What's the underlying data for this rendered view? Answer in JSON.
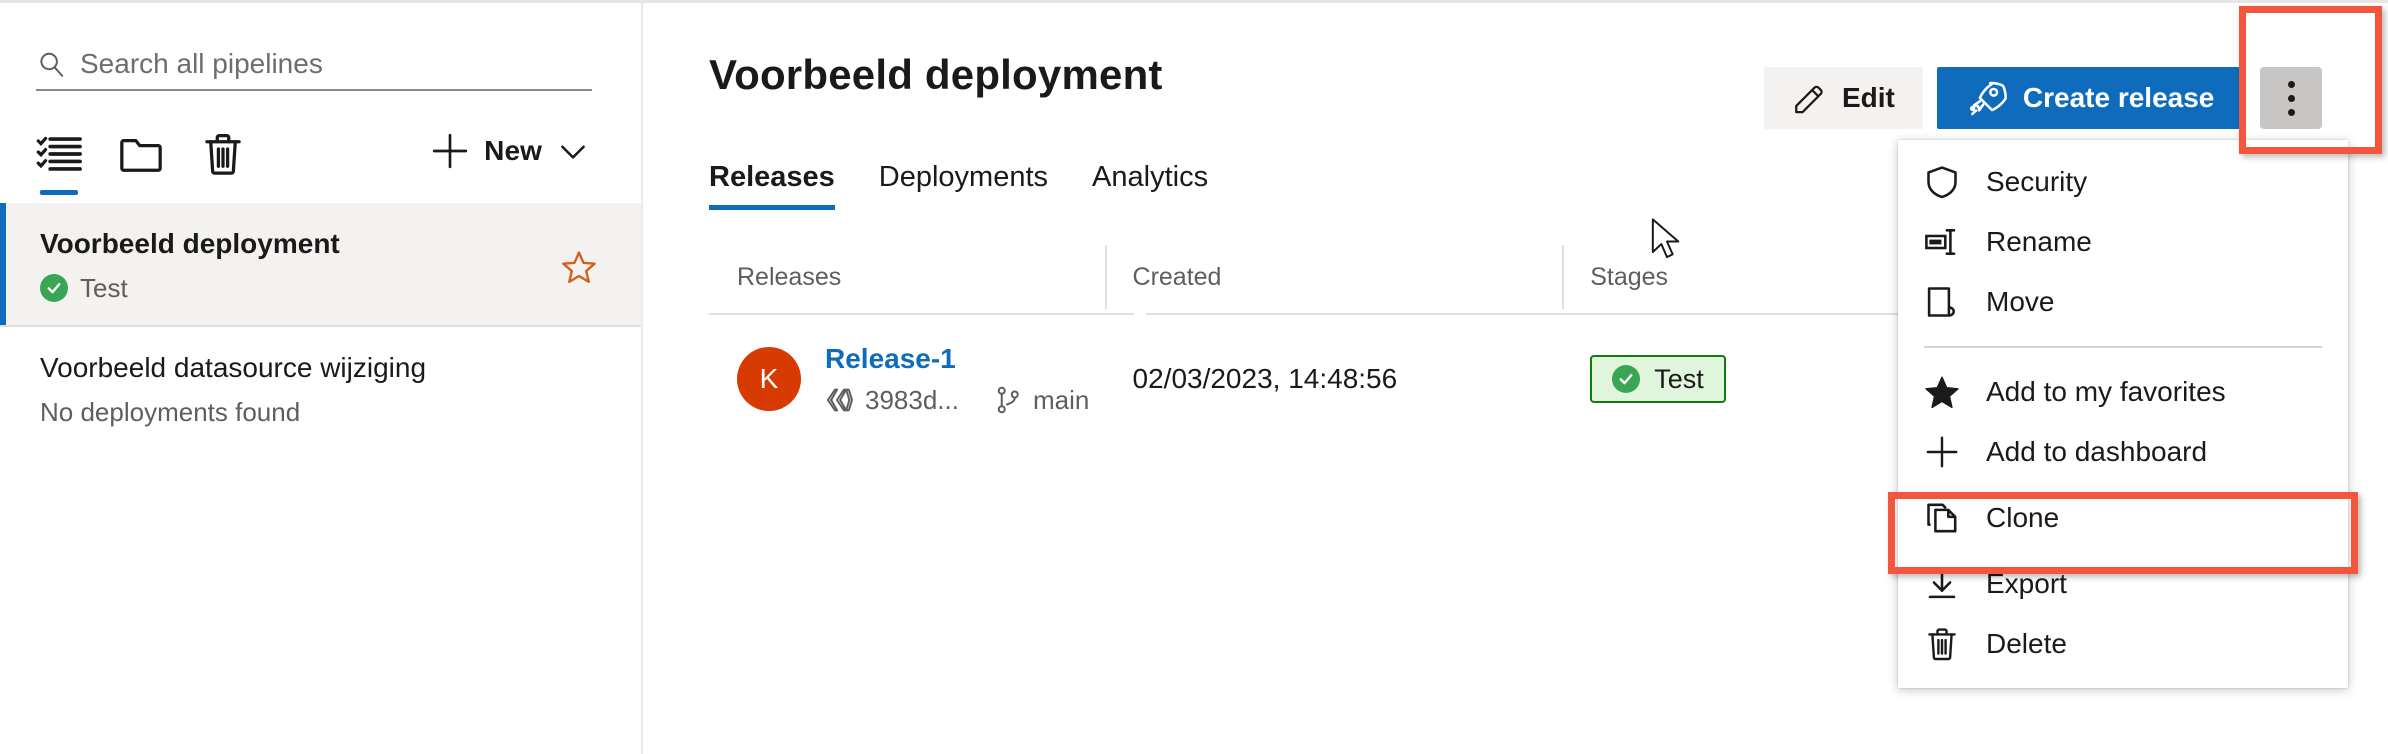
{
  "sidebar": {
    "search": {
      "placeholder": "Search all pipelines",
      "value": "",
      "icon": "search-icon"
    },
    "toolbar": {
      "icons": [
        {
          "name": "pipelines-list-icon",
          "active": true
        },
        {
          "name": "folder-icon",
          "active": false
        },
        {
          "name": "recycle-bin-icon",
          "active": false
        }
      ],
      "new_label": "New",
      "plus_icon": "plus-icon",
      "chevron_icon": "chevron-down-icon"
    },
    "pipelines": [
      {
        "name": "Voorbeeld deployment",
        "status": "Test",
        "status_icon": "check-circle-icon",
        "selected": true,
        "favorite_icon": "star-outline-icon"
      },
      {
        "name": "Voorbeeld datasource wijziging",
        "status": "No deployments found",
        "status_icon": "",
        "selected": false,
        "favorite_icon": ""
      }
    ]
  },
  "main": {
    "title": "Voorbeeld deployment",
    "actions": {
      "edit_label": "Edit",
      "edit_icon": "pencil-icon",
      "create_label": "Create release",
      "create_icon": "rocket-icon",
      "more_label": "More options",
      "more_icon": "more-vertical-icon"
    },
    "tabs": [
      {
        "label": "Releases",
        "active": true
      },
      {
        "label": "Deployments",
        "active": false
      },
      {
        "label": "Analytics",
        "active": false
      }
    ],
    "table": {
      "columns": [
        "Releases",
        "Created",
        "Stages"
      ],
      "rows": [
        {
          "avatar_initial": "K",
          "release_name": "Release-1",
          "commit_icon": "commit-icon",
          "commit": "3983d...",
          "branch_icon": "branch-icon",
          "branch": "main",
          "created": "02/03/2023, 14:48:56",
          "stage_label": "Test",
          "stage_icon": "check-circle-icon"
        }
      ]
    },
    "grid_icon": "table-grid-icon"
  },
  "context_menu": {
    "items": [
      {
        "label": "Security",
        "icon": "shield-icon",
        "separator_after": false
      },
      {
        "label": "Rename",
        "icon": "rename-icon",
        "separator_after": false
      },
      {
        "label": "Move",
        "icon": "move-icon",
        "separator_after": true
      },
      {
        "label": "Add to my favorites",
        "icon": "star-filled-icon",
        "separator_after": false
      },
      {
        "label": "Add to dashboard",
        "icon": "plus-icon",
        "separator_after": false
      },
      {
        "label": "Clone",
        "icon": "copy-icon",
        "separator_after": false,
        "highlighted": true
      },
      {
        "label": "Export",
        "icon": "download-icon",
        "separator_after": false
      },
      {
        "label": "Delete",
        "icon": "trash-icon",
        "separator_after": false
      }
    ]
  },
  "annotations": {
    "highlight_color": "#f4553d",
    "boxes": [
      "more-options-button",
      "clone-menu-item"
    ]
  },
  "colors": {
    "accent_blue": "#0f6cbd",
    "avatar_orange": "#d83b01",
    "success_green": "#107c10",
    "stage_bg": "#dff6dd",
    "favorite_orange": "#d4601b",
    "selected_row_bg": "#f3f2f1",
    "more_button_bg": "#c8c6c4"
  }
}
